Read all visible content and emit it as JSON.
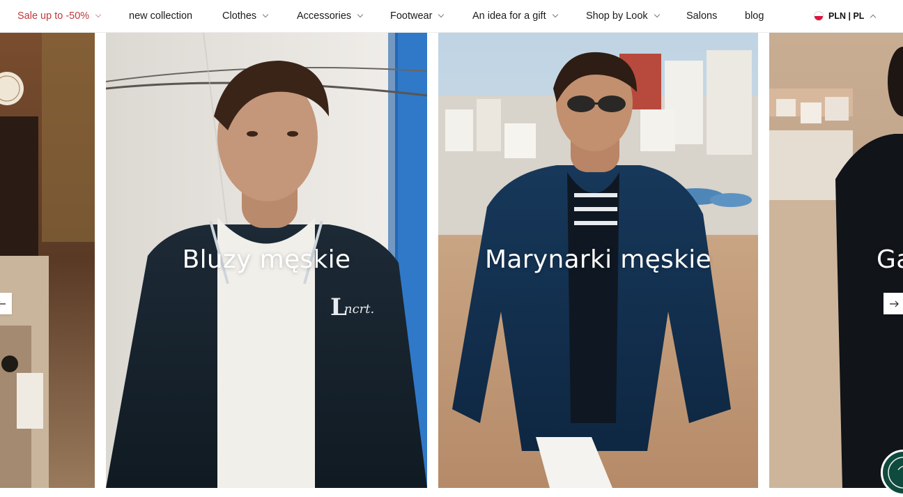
{
  "nav": {
    "items": [
      {
        "label": "Sale up to -50%",
        "has_dropdown": true
      },
      {
        "label": "new collection",
        "has_dropdown": false
      },
      {
        "label": "Clothes",
        "has_dropdown": true
      },
      {
        "label": "Accessories",
        "has_dropdown": true
      },
      {
        "label": "Footwear",
        "has_dropdown": true
      },
      {
        "label": "An idea for a gift",
        "has_dropdown": true
      },
      {
        "label": "Shop by Look",
        "has_dropdown": true
      },
      {
        "label": "Salons",
        "has_dropdown": false
      },
      {
        "label": "blog",
        "has_dropdown": false
      }
    ],
    "locale": {
      "label": "PLN | PL",
      "flag_icon": "poland-flag-icon"
    },
    "colors": {
      "sale": "#c0383c",
      "text": "#1b1b1b"
    }
  },
  "carousel": {
    "cards": [
      {
        "title": ""
      },
      {
        "title": "Bluzy męskie"
      },
      {
        "title": "Marynarki męskie"
      },
      {
        "title": "Ga"
      }
    ],
    "prev_icon": "arrow-left-icon",
    "next_icon": "arrow-right-icon"
  },
  "chat": {
    "icon": "chat-assistant-icon"
  }
}
